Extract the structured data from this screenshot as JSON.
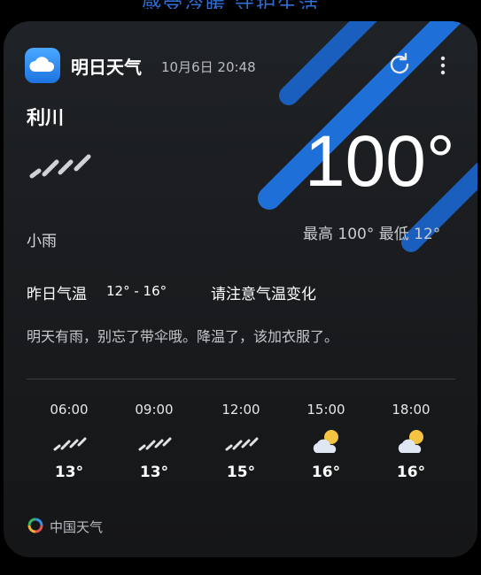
{
  "top_strip": {
    "text": "感受冷暖 守护生活"
  },
  "header": {
    "app_name": "明日天气",
    "update_time": "10月6日 20:48",
    "refresh_icon": "refresh-icon",
    "more_icon": "more-vertical-icon"
  },
  "current": {
    "city": "利川",
    "condition": "小雨",
    "condition_icon": "light-rain-icon",
    "temperature": "100°",
    "hilo": "最高 100°  最低 12°"
  },
  "yesterday": {
    "label": "昨日气温",
    "range": "12° - 16°",
    "notice": "请注意气温变化"
  },
  "advice": "明天有雨，别忘了带伞哦。降温了，该加衣服了。",
  "hourly": [
    {
      "time": "06:00",
      "icon": "light-rain-icon",
      "temp": "13°"
    },
    {
      "time": "09:00",
      "icon": "light-rain-icon",
      "temp": "13°"
    },
    {
      "time": "12:00",
      "icon": "light-rain-icon",
      "temp": "15°"
    },
    {
      "time": "15:00",
      "icon": "partly-cloudy-icon",
      "temp": "16°"
    },
    {
      "time": "18:00",
      "icon": "partly-cloudy-icon",
      "temp": "16°"
    }
  ],
  "footer": {
    "brand": "中国天气",
    "logo_icon": "weather-china-logo-icon"
  },
  "colors": {
    "card_bg": "#1a1c1f",
    "accent_blue": "#1e6fd9",
    "sun_yellow": "#f5c542"
  }
}
